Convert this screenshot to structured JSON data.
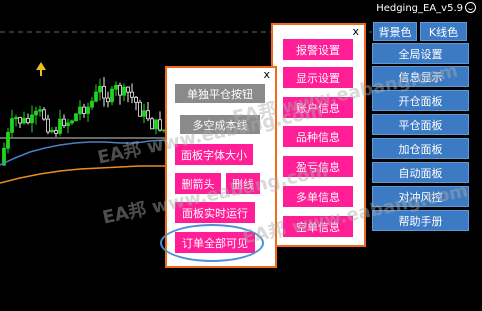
{
  "window": {
    "title": "Hedging_EA_v5.9"
  },
  "top_tabs": {
    "background_color": "背景色",
    "kline_color": "K线色"
  },
  "right_menu": [
    "全局设置",
    "信息显示",
    "开仓面板",
    "平仓面板",
    "加仓面板",
    "自动面板",
    "对冲风控",
    "帮助手册"
  ],
  "middle_panel": {
    "close": "x",
    "items": [
      "报警设置",
      "显示设置",
      "账户信息",
      "品种信息",
      "盈亏信息",
      "多单信息",
      "空单信息"
    ]
  },
  "left_panel": {
    "close": "x",
    "single_close_label": "单独平仓按钮",
    "cost_line_label": "多空成本线",
    "font_size_label": "面板字体大小",
    "delete_arrow_label": "删箭头",
    "delete_line_label": "删线",
    "realtime_label": "面板实时运行",
    "all_visible_label": "订单全部可见"
  },
  "watermark": "EA邦 www.eabang.com",
  "colors": {
    "panel_border": "#f06a1a",
    "pink_button": "#ff1e96",
    "gray_button": "#8a8a8a",
    "blue_button": "#3c7bc4",
    "highlight_ellipse": "#4a8fd8"
  },
  "icons": {
    "title_smile": "smile-icon"
  }
}
